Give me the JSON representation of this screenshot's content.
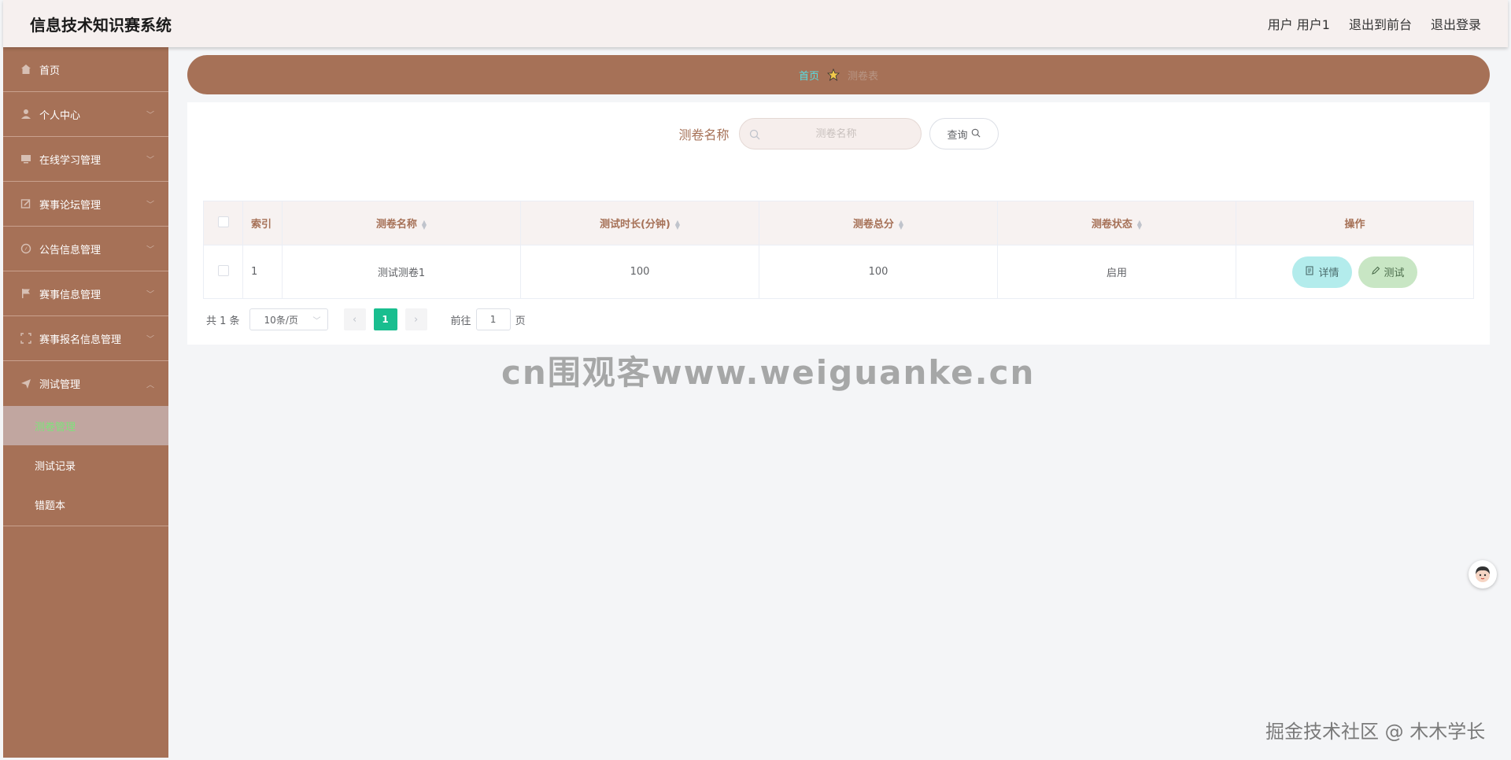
{
  "header": {
    "title": "信息技术知识赛系统",
    "user_label": "用户 用户1",
    "to_front": "退出到前台",
    "logout": "退出登录"
  },
  "sidebar": {
    "items": [
      {
        "label": "首页",
        "icon": "home-icon"
      },
      {
        "label": "个人中心",
        "icon": "user-icon"
      },
      {
        "label": "在线学习管理",
        "icon": "monitor-icon"
      },
      {
        "label": "赛事论坛管理",
        "icon": "edit-icon"
      },
      {
        "label": "公告信息管理",
        "icon": "compass-icon"
      },
      {
        "label": "赛事信息管理",
        "icon": "flag-icon"
      },
      {
        "label": "赛事报名信息管理",
        "icon": "fullscreen-icon"
      },
      {
        "label": "测试管理",
        "icon": "send-icon"
      }
    ],
    "submenu": [
      {
        "label": "测卷管理"
      },
      {
        "label": "测试记录"
      },
      {
        "label": "错题本"
      }
    ]
  },
  "breadcrumb": {
    "home": "首页",
    "current": "测卷表"
  },
  "search": {
    "label": "测卷名称",
    "placeholder": "测卷名称",
    "button": "查询"
  },
  "table": {
    "headers": [
      "索引",
      "测卷名称",
      "测试时长(分钟)",
      "测卷总分",
      "测卷状态",
      "操作"
    ],
    "rows": [
      {
        "index": "1",
        "name": "测试测卷1",
        "duration": "100",
        "score": "100",
        "status": "启用"
      }
    ],
    "detail_btn": "详情",
    "test_btn": "测试"
  },
  "pagination": {
    "total": "共 1 条",
    "page_size": "10条/页",
    "current_page": "1",
    "goto_label": "前往",
    "goto_value": "1",
    "page_unit": "页"
  },
  "overlays": {
    "watermark": "cn围观客www.weiguanke.cn",
    "footer": "掘金技术社区 @ 木木学长"
  },
  "colors": {
    "sidebar": "#a67157",
    "header": "#f6f0ef",
    "accent_active": "#7ee37a",
    "page_active": "#19be8f"
  }
}
